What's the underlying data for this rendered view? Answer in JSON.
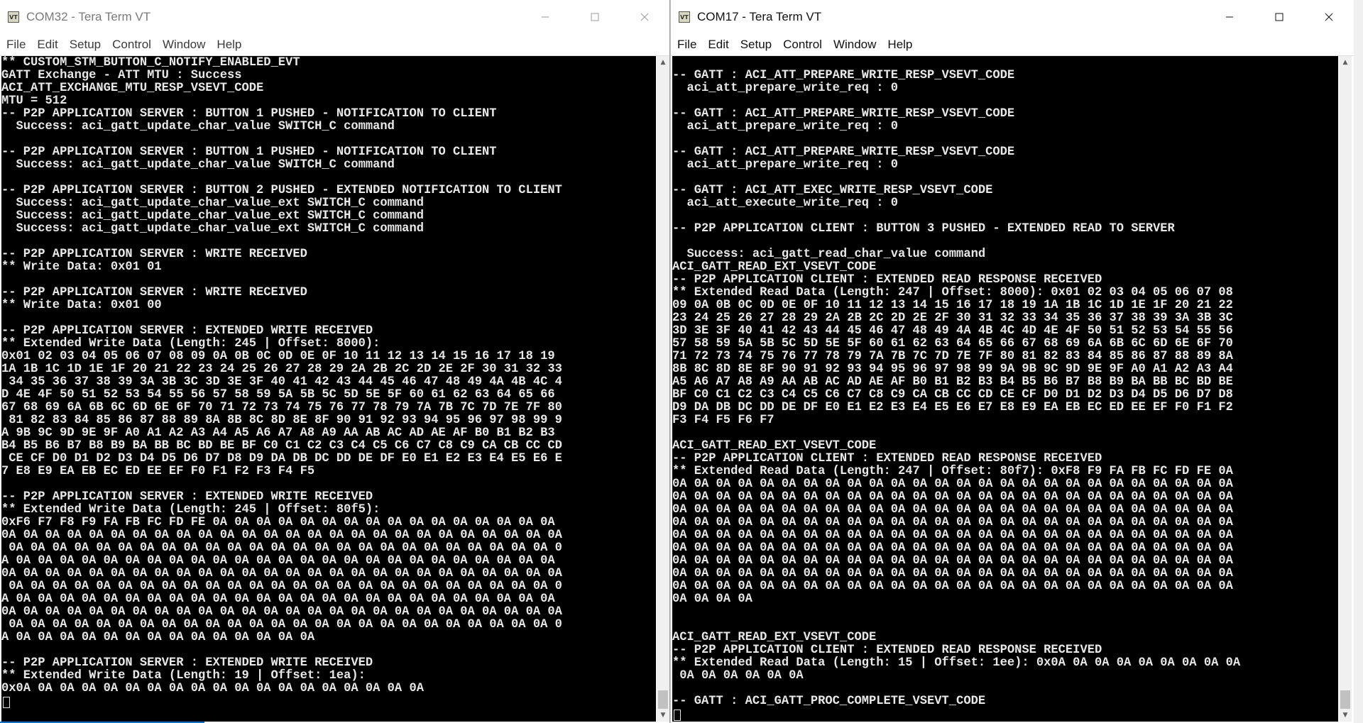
{
  "left_window": {
    "title": "COM32 - Tera Term VT",
    "app_icon_text": "VT",
    "menu": [
      "File",
      "Edit",
      "Setup",
      "Control",
      "Window",
      "Help"
    ],
    "lines": [
      "** CUSTOM_STM_BUTTON_C_NOTIFY_ENABLED_EVT",
      "GATT Exchange - ATT MTU : Success",
      "ACI_ATT_EXCHANGE_MTU_RESP_VSEVT_CODE",
      "MTU = 512",
      "-- P2P APPLICATION SERVER : BUTTON 1 PUSHED - NOTIFICATION TO CLIENT",
      "  Success: aci_gatt_update_char_value SWITCH_C command",
      "",
      "-- P2P APPLICATION SERVER : BUTTON 1 PUSHED - NOTIFICATION TO CLIENT",
      "  Success: aci_gatt_update_char_value SWITCH_C command",
      "",
      "-- P2P APPLICATION SERVER : BUTTON 2 PUSHED - EXTENDED NOTIFICATION TO CLIENT",
      "  Success: aci_gatt_update_char_value_ext SWITCH_C command",
      "  Success: aci_gatt_update_char_value_ext SWITCH_C command",
      "  Success: aci_gatt_update_char_value_ext SWITCH_C command",
      "",
      "-- P2P APPLICATION SERVER : WRITE RECEIVED",
      "** Write Data: 0x01 01",
      "",
      "-- P2P APPLICATION SERVER : WRITE RECEIVED",
      "** Write Data: 0x01 00",
      "",
      "-- P2P APPLICATION SERVER : EXTENDED WRITE RECEIVED",
      "** Extended Write Data (Length: 245 | Offset: 8000):",
      "0x01 02 03 04 05 06 07 08 09 0A 0B 0C 0D 0E 0F 10 11 12 13 14 15 16 17 18 19",
      "1A 1B 1C 1D 1E 1F 20 21 22 23 24 25 26 27 28 29 2A 2B 2C 2D 2E 2F 30 31 32 33",
      " 34 35 36 37 38 39 3A 3B 3C 3D 3E 3F 40 41 42 43 44 45 46 47 48 49 4A 4B 4C 4",
      "D 4E 4F 50 51 52 53 54 55 56 57 58 59 5A 5B 5C 5D 5E 5F 60 61 62 63 64 65 66",
      "67 68 69 6A 6B 6C 6D 6E 6F 70 71 72 73 74 75 76 77 78 79 7A 7B 7C 7D 7E 7F 80",
      " 81 82 83 84 85 86 87 88 89 8A 8B 8C 8D 8E 8F 90 91 92 93 94 95 96 97 98 99 9",
      "A 9B 9C 9D 9E 9F A0 A1 A2 A3 A4 A5 A6 A7 A8 A9 AA AB AC AD AE AF B0 B1 B2 B3",
      "B4 B5 B6 B7 B8 B9 BA BB BC BD BE BF C0 C1 C2 C3 C4 C5 C6 C7 C8 C9 CA CB CC CD",
      " CE CF D0 D1 D2 D3 D4 D5 D6 D7 D8 D9 DA DB DC DD DE DF E0 E1 E2 E3 E4 E5 E6 E",
      "7 E8 E9 EA EB EC ED EE EF F0 F1 F2 F3 F4 F5",
      "",
      "-- P2P APPLICATION SERVER : EXTENDED WRITE RECEIVED",
      "** Extended Write Data (Length: 245 | Offset: 80f5):",
      "0xF6 F7 F8 F9 FA FB FC FD FE 0A 0A 0A 0A 0A 0A 0A 0A 0A 0A 0A 0A 0A 0A 0A 0A",
      "0A 0A 0A 0A 0A 0A 0A 0A 0A 0A 0A 0A 0A 0A 0A 0A 0A 0A 0A 0A 0A 0A 0A 0A 0A 0A",
      " 0A 0A 0A 0A 0A 0A 0A 0A 0A 0A 0A 0A 0A 0A 0A 0A 0A 0A 0A 0A 0A 0A 0A 0A 0A 0",
      "A 0A 0A 0A 0A 0A 0A 0A 0A 0A 0A 0A 0A 0A 0A 0A 0A 0A 0A 0A 0A 0A 0A 0A 0A 0A",
      "0A 0A 0A 0A 0A 0A 0A 0A 0A 0A 0A 0A 0A 0A 0A 0A 0A 0A 0A 0A 0A 0A 0A 0A 0A 0A",
      " 0A 0A 0A 0A 0A 0A 0A 0A 0A 0A 0A 0A 0A 0A 0A 0A 0A 0A 0A 0A 0A 0A 0A 0A 0A 0",
      "A 0A 0A 0A 0A 0A 0A 0A 0A 0A 0A 0A 0A 0A 0A 0A 0A 0A 0A 0A 0A 0A 0A 0A 0A 0A",
      "0A 0A 0A 0A 0A 0A 0A 0A 0A 0A 0A 0A 0A 0A 0A 0A 0A 0A 0A 0A 0A 0A 0A 0A 0A 0A",
      " 0A 0A 0A 0A 0A 0A 0A 0A 0A 0A 0A 0A 0A 0A 0A 0A 0A 0A 0A 0A 0A 0A 0A 0A 0A 0",
      "A 0A 0A 0A 0A 0A 0A 0A 0A 0A 0A 0A 0A 0A 0A",
      "",
      "-- P2P APPLICATION SERVER : EXTENDED WRITE RECEIVED",
      "** Extended Write Data (Length: 19 | Offset: 1ea):",
      "0x0A 0A 0A 0A 0A 0A 0A 0A 0A 0A 0A 0A 0A 0A 0A 0A 0A 0A 0A"
    ]
  },
  "right_window": {
    "title": "COM17 - Tera Term VT",
    "app_icon_text": "VT",
    "menu": [
      "File",
      "Edit",
      "Setup",
      "Control",
      "Window",
      "Help"
    ],
    "lines": [
      "",
      "-- GATT : ACI_ATT_PREPARE_WRITE_RESP_VSEVT_CODE",
      "  aci_att_prepare_write_req : 0",
      "",
      "-- GATT : ACI_ATT_PREPARE_WRITE_RESP_VSEVT_CODE",
      "  aci_att_prepare_write_req : 0",
      "",
      "-- GATT : ACI_ATT_PREPARE_WRITE_RESP_VSEVT_CODE",
      "  aci_att_prepare_write_req : 0",
      "",
      "-- GATT : ACI_ATT_EXEC_WRITE_RESP_VSEVT_CODE",
      "  aci_att_execute_write_req : 0",
      "",
      "-- P2P APPLICATION CLIENT : BUTTON 3 PUSHED - EXTENDED READ TO SERVER",
      "",
      "  Success: aci_gatt_read_char_value command",
      "ACI_GATT_READ_EXT_VSEVT_CODE",
      "-- P2P APPLICATION CLIENT : EXTENDED READ RESPONSE RECEIVED",
      "** Extended Read Data (Length: 247 | Offset: 8000): 0x01 02 03 04 05 06 07 08",
      "09 0A 0B 0C 0D 0E 0F 10 11 12 13 14 15 16 17 18 19 1A 1B 1C 1D 1E 1F 20 21 22",
      "23 24 25 26 27 28 29 2A 2B 2C 2D 2E 2F 30 31 32 33 34 35 36 37 38 39 3A 3B 3C",
      "3D 3E 3F 40 41 42 43 44 45 46 47 48 49 4A 4B 4C 4D 4E 4F 50 51 52 53 54 55 56",
      "57 58 59 5A 5B 5C 5D 5E 5F 60 61 62 63 64 65 66 67 68 69 6A 6B 6C 6D 6E 6F 70",
      "71 72 73 74 75 76 77 78 79 7A 7B 7C 7D 7E 7F 80 81 82 83 84 85 86 87 88 89 8A",
      "8B 8C 8D 8E 8F 90 91 92 93 94 95 96 97 98 99 9A 9B 9C 9D 9E 9F A0 A1 A2 A3 A4",
      "A5 A6 A7 A8 A9 AA AB AC AD AE AF B0 B1 B2 B3 B4 B5 B6 B7 B8 B9 BA BB BC BD BE",
      "BF C0 C1 C2 C3 C4 C5 C6 C7 C8 C9 CA CB CC CD CE CF D0 D1 D2 D3 D4 D5 D6 D7 D8",
      "D9 DA DB DC DD DE DF E0 E1 E2 E3 E4 E5 E6 E7 E8 E9 EA EB EC ED EE EF F0 F1 F2",
      "F3 F4 F5 F6 F7",
      "",
      "ACI_GATT_READ_EXT_VSEVT_CODE",
      "-- P2P APPLICATION CLIENT : EXTENDED READ RESPONSE RECEIVED",
      "** Extended Read Data (Length: 247 | Offset: 80f7): 0xF8 F9 FA FB FC FD FE 0A",
      "0A 0A 0A 0A 0A 0A 0A 0A 0A 0A 0A 0A 0A 0A 0A 0A 0A 0A 0A 0A 0A 0A 0A 0A 0A 0A",
      "0A 0A 0A 0A 0A 0A 0A 0A 0A 0A 0A 0A 0A 0A 0A 0A 0A 0A 0A 0A 0A 0A 0A 0A 0A 0A",
      "0A 0A 0A 0A 0A 0A 0A 0A 0A 0A 0A 0A 0A 0A 0A 0A 0A 0A 0A 0A 0A 0A 0A 0A 0A 0A",
      "0A 0A 0A 0A 0A 0A 0A 0A 0A 0A 0A 0A 0A 0A 0A 0A 0A 0A 0A 0A 0A 0A 0A 0A 0A 0A",
      "0A 0A 0A 0A 0A 0A 0A 0A 0A 0A 0A 0A 0A 0A 0A 0A 0A 0A 0A 0A 0A 0A 0A 0A 0A 0A",
      "0A 0A 0A 0A 0A 0A 0A 0A 0A 0A 0A 0A 0A 0A 0A 0A 0A 0A 0A 0A 0A 0A 0A 0A 0A 0A",
      "0A 0A 0A 0A 0A 0A 0A 0A 0A 0A 0A 0A 0A 0A 0A 0A 0A 0A 0A 0A 0A 0A 0A 0A 0A 0A",
      "0A 0A 0A 0A 0A 0A 0A 0A 0A 0A 0A 0A 0A 0A 0A 0A 0A 0A 0A 0A 0A 0A 0A 0A 0A 0A",
      "0A 0A 0A 0A 0A 0A 0A 0A 0A 0A 0A 0A 0A 0A 0A 0A 0A 0A 0A 0A 0A 0A 0A 0A 0A 0A",
      "0A 0A 0A 0A",
      "",
      "",
      "ACI_GATT_READ_EXT_VSEVT_CODE",
      "-- P2P APPLICATION CLIENT : EXTENDED READ RESPONSE RECEIVED",
      "** Extended Read Data (Length: 15 | Offset: 1ee): 0x0A 0A 0A 0A 0A 0A 0A 0A 0A",
      " 0A 0A 0A 0A 0A 0A",
      "",
      "-- GATT : ACI_GATT_PROC_COMPLETE_VSEVT_CODE"
    ]
  }
}
